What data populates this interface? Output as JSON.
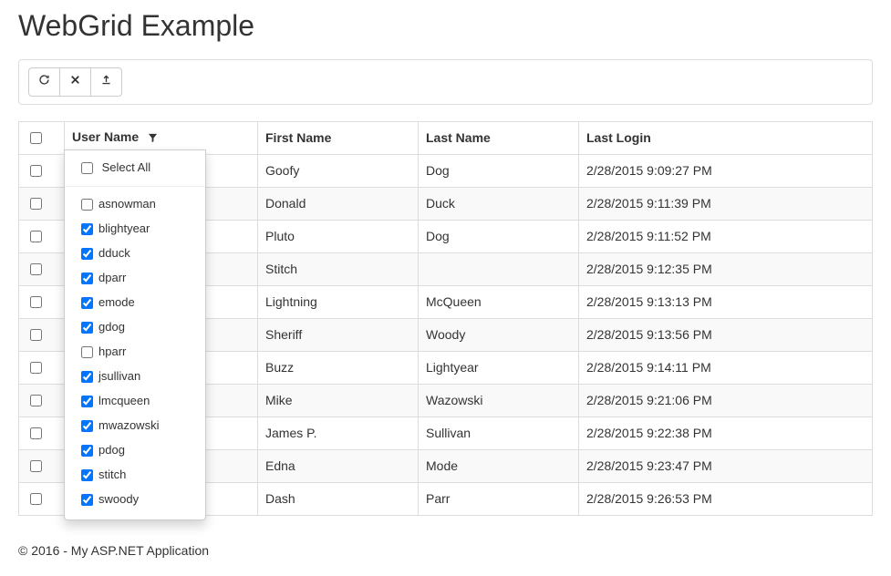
{
  "page": {
    "title": "WebGrid Example",
    "footer": "© 2016 - My ASP.NET Application"
  },
  "toolbar": {
    "refresh_title": "Refresh",
    "clear_title": "Clear filters",
    "export_title": "Export"
  },
  "columns": {
    "username": "User Name",
    "firstname": "First Name",
    "lastname": "Last Name",
    "lastlogin": "Last Login"
  },
  "rows": [
    {
      "first": "Goofy",
      "last": "Dog",
      "login": "2/28/2015 9:09:27 PM"
    },
    {
      "first": "Donald",
      "last": "Duck",
      "login": "2/28/2015 9:11:39 PM"
    },
    {
      "first": "Pluto",
      "last": "Dog",
      "login": "2/28/2015 9:11:52 PM"
    },
    {
      "first": "Stitch",
      "last": "",
      "login": "2/28/2015 9:12:35 PM"
    },
    {
      "first": "Lightning",
      "last": "McQueen",
      "login": "2/28/2015 9:13:13 PM"
    },
    {
      "first": "Sheriff",
      "last": "Woody",
      "login": "2/28/2015 9:13:56 PM"
    },
    {
      "first": "Buzz",
      "last": "Lightyear",
      "login": "2/28/2015 9:14:11 PM"
    },
    {
      "first": "Mike",
      "last": "Wazowski",
      "login": "2/28/2015 9:21:06 PM"
    },
    {
      "first": "James P.",
      "last": "Sullivan",
      "login": "2/28/2015 9:22:38 PM"
    },
    {
      "first": "Edna",
      "last": "Mode",
      "login": "2/28/2015 9:23:47 PM"
    },
    {
      "first": "Dash",
      "last": "Parr",
      "login": "2/28/2015 9:26:53 PM"
    }
  ],
  "filter": {
    "select_all_label": "Select All",
    "select_all_checked": false,
    "options": [
      {
        "label": "asnowman",
        "checked": false
      },
      {
        "label": "blightyear",
        "checked": true
      },
      {
        "label": "dduck",
        "checked": true
      },
      {
        "label": "dparr",
        "checked": true
      },
      {
        "label": "emode",
        "checked": true
      },
      {
        "label": "gdog",
        "checked": true
      },
      {
        "label": "hparr",
        "checked": false
      },
      {
        "label": "jsullivan",
        "checked": true
      },
      {
        "label": "lmcqueen",
        "checked": true
      },
      {
        "label": "mwazowski",
        "checked": true
      },
      {
        "label": "pdog",
        "checked": true
      },
      {
        "label": "stitch",
        "checked": true
      },
      {
        "label": "swoody",
        "checked": true
      }
    ]
  }
}
